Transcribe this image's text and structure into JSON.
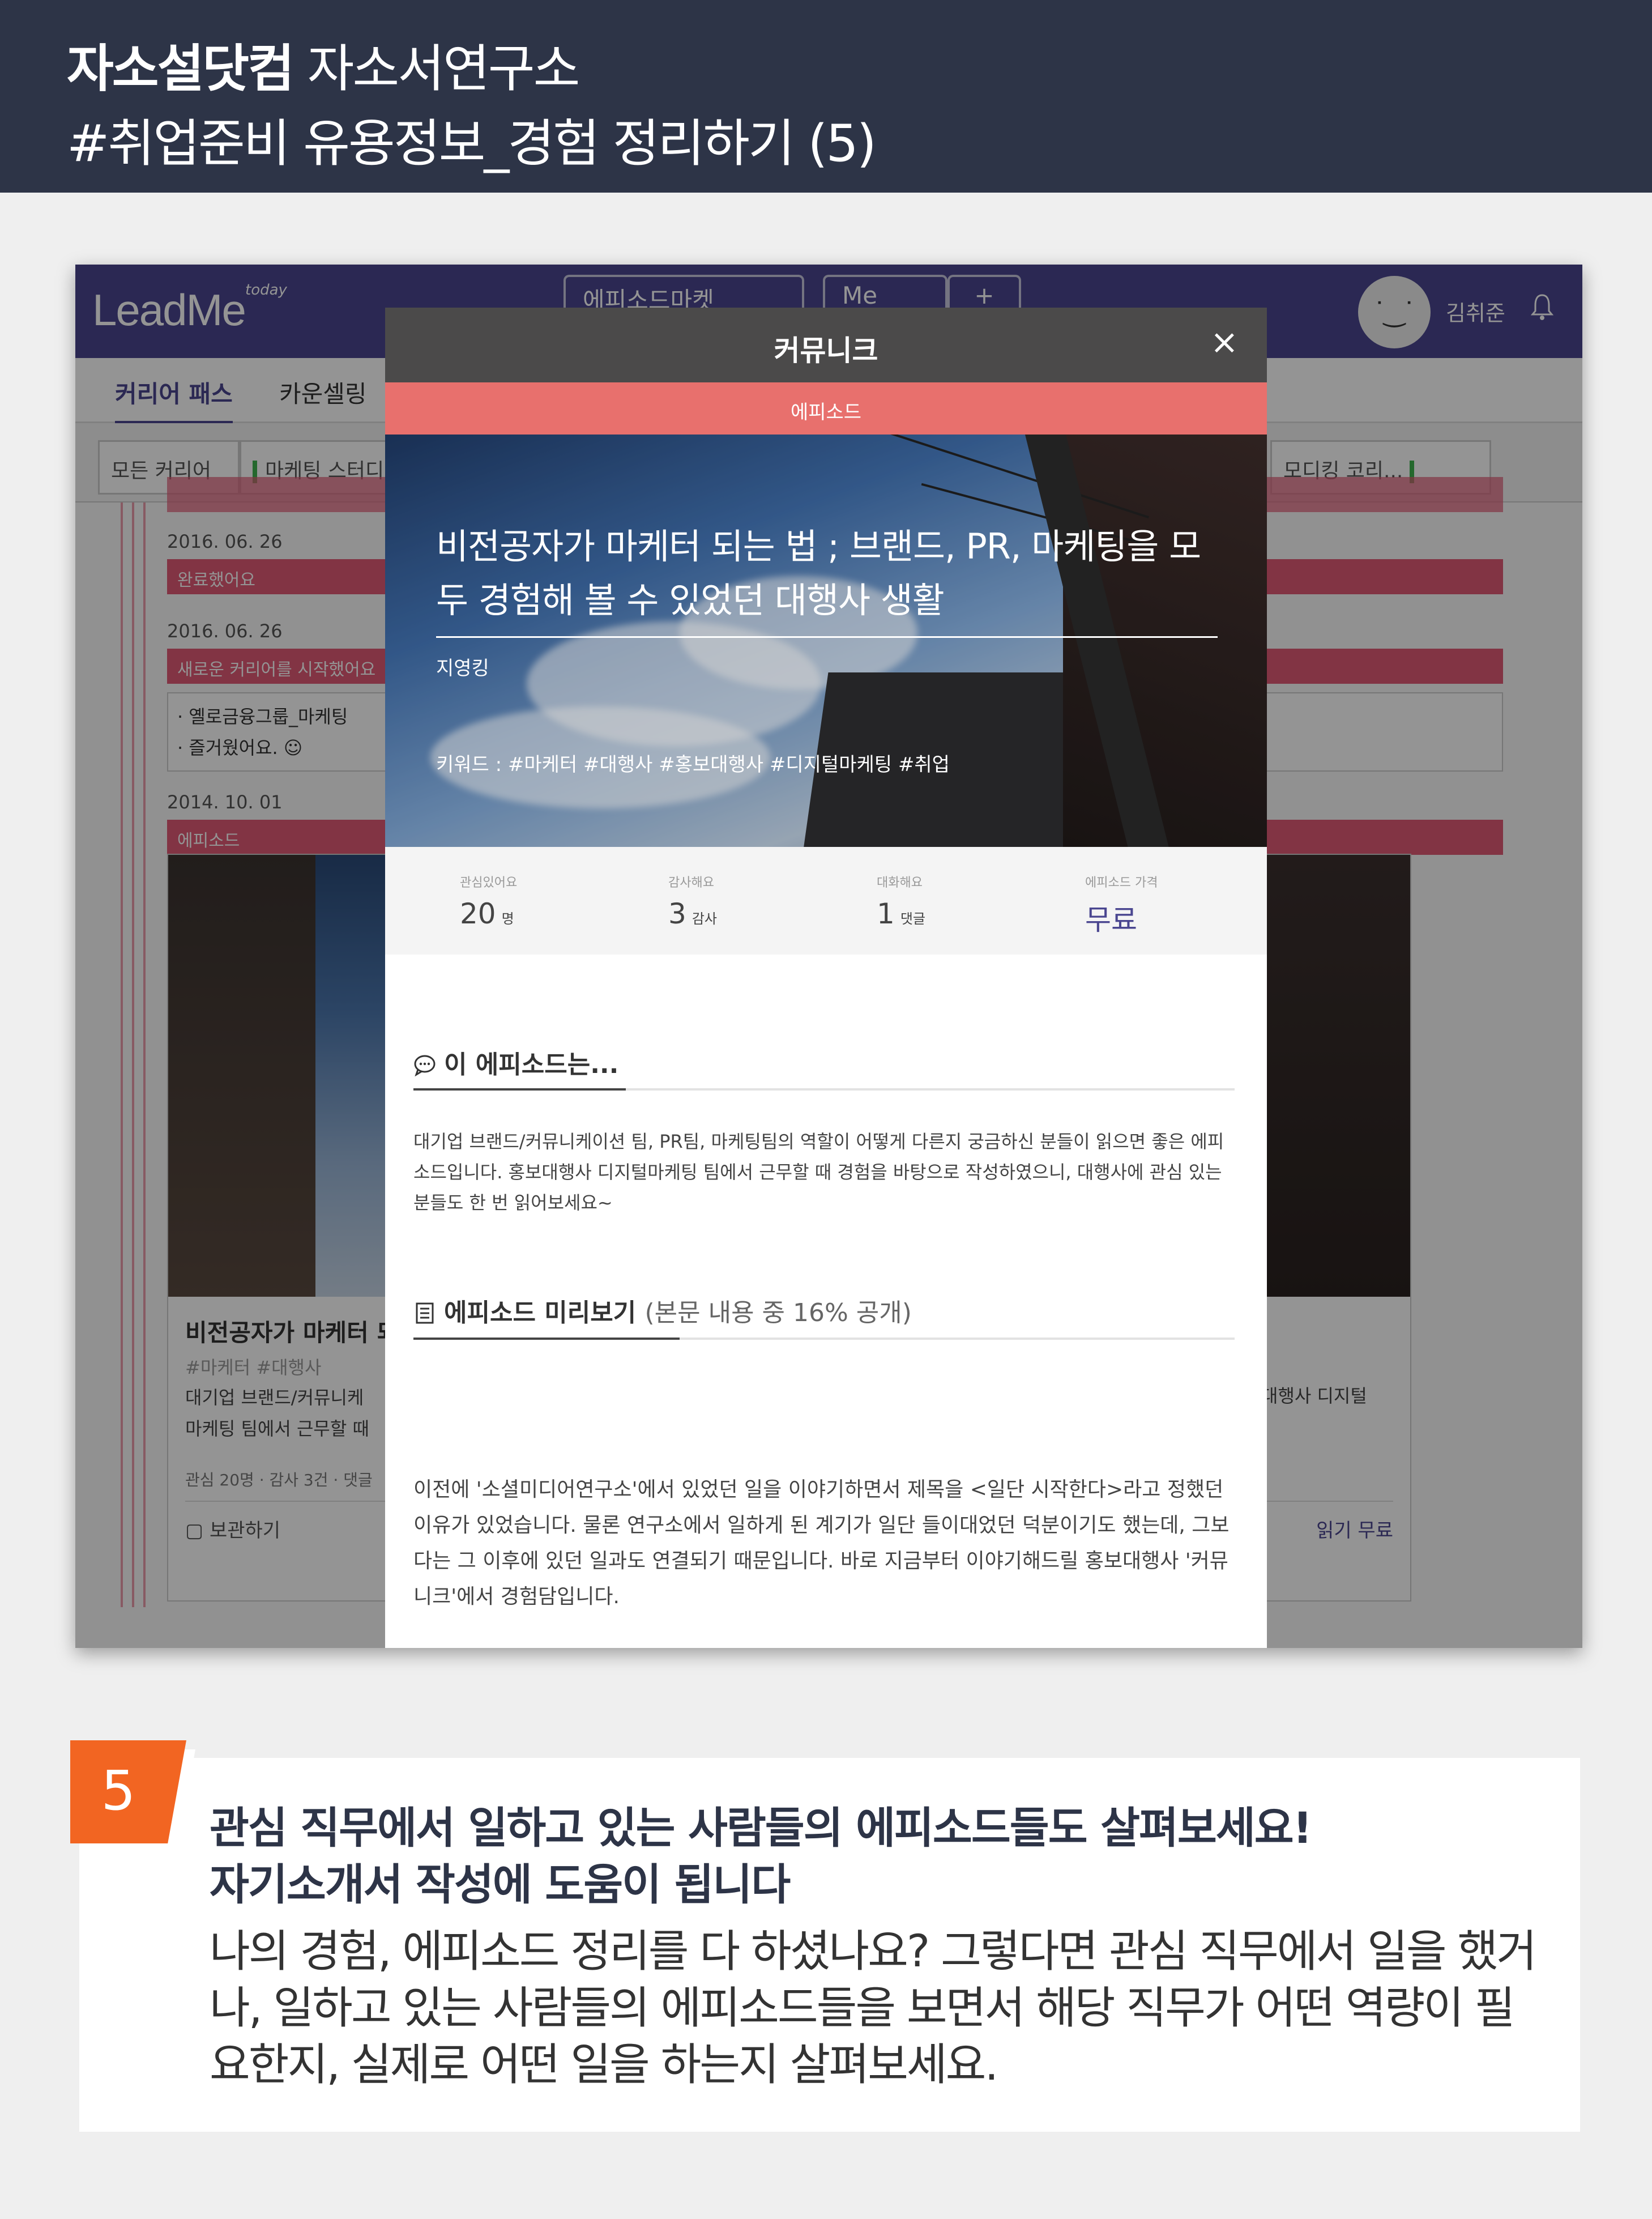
{
  "banner": {
    "brand": "자소설닷컴",
    "brand_sub": "자소서연구소",
    "subtitle": "#취업준비 유용정보_경험 정리하기 (5)"
  },
  "app": {
    "logo": "LeadMe",
    "logo_sub": "today",
    "nav_buttons": [
      "에피소드마켓",
      "Me",
      "+"
    ],
    "user_name": "김취준",
    "tabs": [
      "커리어 패스",
      "카운셀링"
    ],
    "filters": [
      "모든 커리어",
      "마케팅 스터디",
      "모디킹 코리..."
    ],
    "timeline": [
      {
        "date": "2016. 06. 26",
        "bar": "완료했어요"
      },
      {
        "date": "2016. 06. 26",
        "bar": "새로운 커리어를 시작했어요"
      },
      {
        "date": "2014. 10. 01",
        "bar": "에피소드"
      }
    ],
    "timeline_text": [
      "· 옐로금융그룹_마케팅",
      "· 즐거웠어요. ☺"
    ],
    "card": {
      "title": "비전공자가 마케터 되",
      "tags": "#마케터  #대행사",
      "desc_line1": "대기업 브랜드/커뮤니케",
      "desc_line2": "마케팅 팀에서 근무할 때",
      "right_desc": "대행사 디지털",
      "meta": "관심 20명 · 감사 3건 · 댓글",
      "save": "보관하기",
      "read": "읽기 무료"
    }
  },
  "modal": {
    "title": "커뮤니크",
    "close": "×",
    "ribbon": "에피소드",
    "hero_title": "비전공자가 마케터 되는 법 ; 브랜드, PR, 마케팅을 모두 경험해 볼 수 있었던 대행사 생활",
    "author": "지영킹",
    "keywords": "키워드 : #마케터  #대행사  #홍보대행사  #디지털마케팅  #취업",
    "stats": [
      {
        "label": "관심있어요",
        "value": "20",
        "unit": "명"
      },
      {
        "label": "감사해요",
        "value": "3",
        "unit": "감사"
      },
      {
        "label": "대화해요",
        "value": "1",
        "unit": "댓글"
      },
      {
        "label": "에피소드 가격",
        "value": "무료",
        "unit": ""
      }
    ],
    "section1_title": "이 에피소드는...",
    "section1_body": "대기업 브랜드/커뮤니케이션 팀, PR팀, 마케팅팀의 역할이 어떻게 다른지 궁금하신 분들이 읽으면 좋은 에피소드입니다. 홍보대행사 디지털마케팅 팀에서 근무할 때 경험을 바탕으로 작성하였으니, 대행사에 관심 있는 분들도 한 번 읽어보세요~",
    "section2_title": "에피소드 미리보기",
    "section2_note": "(본문 내용 중 16% 공개)",
    "section2_body": "이전에 '소셜미디어연구소'에서 있었던 일을 이야기하면서 제목을 <일단 시작한다>라고 정했던 이유가 있었습니다. 물론 연구소에서 일하게 된 계기가 일단 들이대었던 덕분이기도 했는데, 그보다는 그 이후에 있던 일과도 연결되기 때문입니다. 바로 지금부터 이야기해드릴 홍보대행사 '커뮤니크'에서 경험담입니다."
  },
  "bottom": {
    "number": "5",
    "heading1": "관심 직무에서 일하고 있는 사람들의 에피소드들도 살펴보세요!",
    "heading2": "자기소개서 작성에 도움이 됩니다",
    "body": "나의 경험, 에피소드 정리를 다 하셨나요? 그렇다면 관심 직무에서 일을 했거나, 일하고 있는 사람들의 에피소드들을 보면서 해당 직무가 어떤 역량이 필요한지, 실제로 어떤 일을 하는지 살펴보세요."
  },
  "colors": {
    "banner_bg": "#2d3447",
    "app_nav": "#4a4690",
    "ribbon": "#e8706d",
    "timeline_bar": "#e05b76",
    "badge": "#f26522"
  }
}
